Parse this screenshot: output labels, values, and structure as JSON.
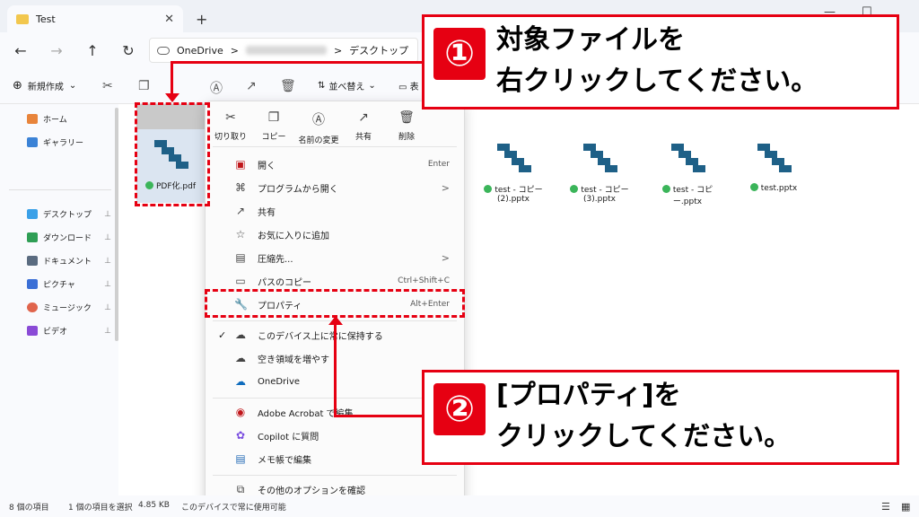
{
  "window": {
    "tab_title": "Test",
    "close": "✕",
    "newtab": "+",
    "minimize": "—",
    "maximize": "☐"
  },
  "nav": {
    "back": "←",
    "forward": "→",
    "up": "↑",
    "refresh": "↻"
  },
  "address": {
    "onedrive": "OneDrive",
    "sep": ">",
    "folder": "デスクトップ"
  },
  "toolbar": {
    "new": "新規作成",
    "sort": "並べ替え",
    "view": "表"
  },
  "sidebar": {
    "items": [
      {
        "label": "ホーム",
        "color": "#e8843b"
      },
      {
        "label": "ギャラリー",
        "color": "#3b82d6"
      },
      {
        "label": "デスクトップ",
        "color": "#3aa0e8"
      },
      {
        "label": "ダウンロード",
        "color": "#2f9e55"
      },
      {
        "label": "ドキュメント",
        "color": "#5a6b80"
      },
      {
        "label": "ピクチャ",
        "color": "#3b6fd6"
      },
      {
        "label": "ミュージック",
        "color": "#e0644c"
      },
      {
        "label": "ビデオ",
        "color": "#8a4ad6"
      }
    ],
    "pin": "📌"
  },
  "files": [
    {
      "name": "PDF化.pdf"
    },
    {
      "name": "test - コピー (2).pptx"
    },
    {
      "name": "test - コピー (3).pptx"
    },
    {
      "name": "test - コピー.pptx"
    },
    {
      "name": "test.pptx"
    }
  ],
  "menu": {
    "quick": [
      "切り取り",
      "コピー",
      "名前の変更",
      "共有",
      "削除"
    ],
    "items": [
      {
        "label": "開く",
        "shortcut": "Enter"
      },
      {
        "label": "プログラムから開く",
        "arrow": ">"
      },
      {
        "label": "共有"
      },
      {
        "label": "お気に入りに追加"
      },
      {
        "label": "圧縮先...",
        "arrow": ">"
      },
      {
        "label": "パスのコピー",
        "shortcut": "Ctrl+Shift+C"
      },
      {
        "label": "プロパティ",
        "shortcut": "Alt+Enter"
      },
      {
        "label": "このデバイス上に常に保持する",
        "check": "✓"
      },
      {
        "label": "空き領域を増やす"
      },
      {
        "label": "OneDrive"
      },
      {
        "label": "Adobe Acrobat で編集"
      },
      {
        "label": "Copilot に質問"
      },
      {
        "label": "メモ帳で編集"
      },
      {
        "label": "その他のオプションを確認"
      }
    ]
  },
  "status": {
    "count": "8 個の項目",
    "selected": "1 個の項目を選択",
    "size": "4.85 KB",
    "info": "このデバイスで常に使用可能"
  },
  "callouts": {
    "one": {
      "num": "①",
      "line1": "対象ファイルを",
      "line2": "右クリックしてください。"
    },
    "two": {
      "num": "②",
      "line1": "[プロパティ]を",
      "line2": "クリックしてください。"
    }
  },
  "colors": {
    "accent": "#e60012",
    "file_icon": "#1e6087"
  }
}
